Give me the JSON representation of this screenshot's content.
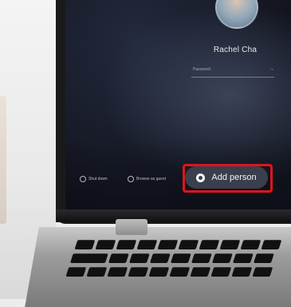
{
  "login_screen": {
    "user_name": "Rachel Cha",
    "password_placeholder": "Password",
    "password_arrow_icon": "arrow-right-icon"
  },
  "shelf": {
    "shut_down_label": "Shut down",
    "browse_as_guest_label": "Browse as guest",
    "add_person_label": "Add person",
    "add_person_icon": "add-person-icon"
  },
  "colors": {
    "highlight": "#e0141b",
    "pill": "#3a3f4d",
    "screen": "#12141e"
  }
}
